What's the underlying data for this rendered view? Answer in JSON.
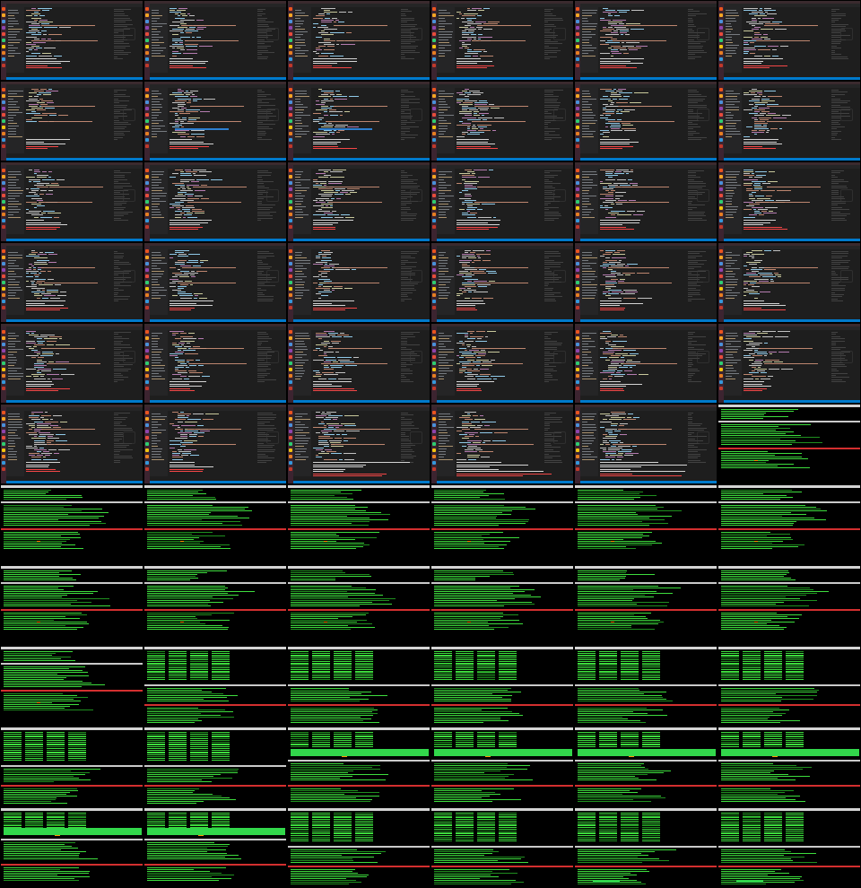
{
  "screen": {
    "description_free": true,
    "rows": 11,
    "columns": 6
  },
  "colors": {
    "editor_background": "#1e1e1e",
    "editor_sidebar": "#252526",
    "editor_statusbar": "#007acc",
    "launcher": "#3c2430",
    "code_keyword": "#c586c0",
    "code_string": "#ce9178",
    "code_function": "#dcdcaa",
    "code_variable": "#9cdcfe",
    "code_plain": "#d4d4d4",
    "code_comment": "#6a9955",
    "code_error": "#f44747",
    "terminal_background": "#000000",
    "terminal_text": "#3ddc3d",
    "terminal_dim": "#1f8f1f",
    "terminal_border_red": "#d32f2f",
    "terminal_border_white": "#c9c9c9",
    "progress_fill": "#32d74b"
  },
  "frames": [
    {
      "kind": "editor"
    },
    {
      "kind": "editor"
    },
    {
      "kind": "editor"
    },
    {
      "kind": "editor"
    },
    {
      "kind": "editor"
    },
    {
      "kind": "editor"
    },
    {
      "kind": "editor",
      "variant": "short"
    },
    {
      "kind": "editor",
      "variant": "selection"
    },
    {
      "kind": "editor",
      "variant": "selection"
    },
    {
      "kind": "editor"
    },
    {
      "kind": "editor"
    },
    {
      "kind": "editor"
    },
    {
      "kind": "editor"
    },
    {
      "kind": "editor"
    },
    {
      "kind": "editor"
    },
    {
      "kind": "editor"
    },
    {
      "kind": "editor"
    },
    {
      "kind": "editor"
    },
    {
      "kind": "editor"
    },
    {
      "kind": "editor"
    },
    {
      "kind": "editor"
    },
    {
      "kind": "editor"
    },
    {
      "kind": "editor"
    },
    {
      "kind": "editor"
    },
    {
      "kind": "editor"
    },
    {
      "kind": "editor"
    },
    {
      "kind": "editor"
    },
    {
      "kind": "editor"
    },
    {
      "kind": "editor"
    },
    {
      "kind": "editor"
    },
    {
      "kind": "editor"
    },
    {
      "kind": "editor"
    },
    {
      "kind": "editor",
      "variant": "terminal-output"
    },
    {
      "kind": "editor",
      "variant": "terminal-output"
    },
    {
      "kind": "editor",
      "variant": "terminal-output"
    },
    {
      "kind": "terminal",
      "variant": "split"
    },
    {
      "kind": "terminal",
      "variant": "split"
    },
    {
      "kind": "terminal",
      "variant": "split"
    },
    {
      "kind": "terminal",
      "variant": "split"
    },
    {
      "kind": "terminal",
      "variant": "split"
    },
    {
      "kind": "terminal",
      "variant": "split"
    },
    {
      "kind": "terminal",
      "variant": "split"
    },
    {
      "kind": "terminal",
      "variant": "split"
    },
    {
      "kind": "terminal",
      "variant": "split"
    },
    {
      "kind": "terminal",
      "variant": "split"
    },
    {
      "kind": "terminal",
      "variant": "split"
    },
    {
      "kind": "terminal",
      "variant": "split"
    },
    {
      "kind": "terminal",
      "variant": "split"
    },
    {
      "kind": "terminal",
      "variant": "split"
    },
    {
      "kind": "terminal",
      "variant": "columns"
    },
    {
      "kind": "terminal",
      "variant": "columns"
    },
    {
      "kind": "terminal",
      "variant": "columns"
    },
    {
      "kind": "terminal",
      "variant": "columns"
    },
    {
      "kind": "terminal",
      "variant": "columns"
    },
    {
      "kind": "terminal",
      "variant": "columns"
    },
    {
      "kind": "terminal",
      "variant": "columns"
    },
    {
      "kind": "terminal",
      "variant": "progress",
      "progress": 1.0
    },
    {
      "kind": "terminal",
      "variant": "progress",
      "progress": 1.0
    },
    {
      "kind": "terminal",
      "variant": "progress",
      "progress": 1.0
    },
    {
      "kind": "terminal",
      "variant": "progress",
      "progress": 1.0
    },
    {
      "kind": "terminal",
      "variant": "progress-top",
      "progress": 1.0
    },
    {
      "kind": "terminal",
      "variant": "progress-top",
      "progress": 1.0
    },
    {
      "kind": "terminal",
      "variant": "columns"
    },
    {
      "kind": "terminal",
      "variant": "columns"
    },
    {
      "kind": "terminal",
      "variant": "columns-bar",
      "progress": 0.5
    },
    {
      "kind": "terminal",
      "variant": "columns-bar",
      "progress": 0.5
    }
  ]
}
